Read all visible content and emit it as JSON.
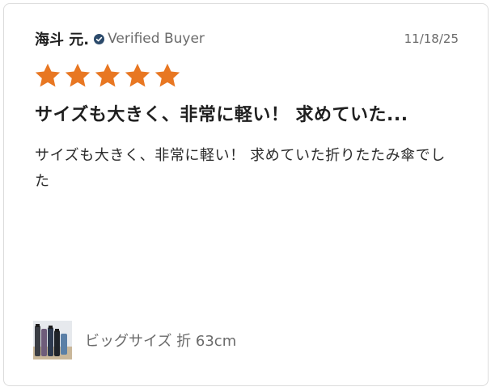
{
  "review": {
    "author": "海斗 元.",
    "verified_label": "Verified Buyer",
    "date": "11/18/25",
    "rating": 5,
    "rating_max": 5,
    "title": "サイズも大きく、非常に軽い！ 求めていた...",
    "body": "サイズも大きく、非常に軽い！ 求めていた折りたたみ傘でした",
    "variant": "ビッグサイズ 折 63cm"
  },
  "colors": {
    "star": "#e87722",
    "verified_icon": "#2b4a6b",
    "text_dark": "#1f1f1f",
    "text_muted": "#6b6b6b",
    "border": "#dcdcdc"
  },
  "icons": {
    "verified": "verified-check-icon",
    "star": "star-icon",
    "thumbnail": "product-thumbnail"
  }
}
